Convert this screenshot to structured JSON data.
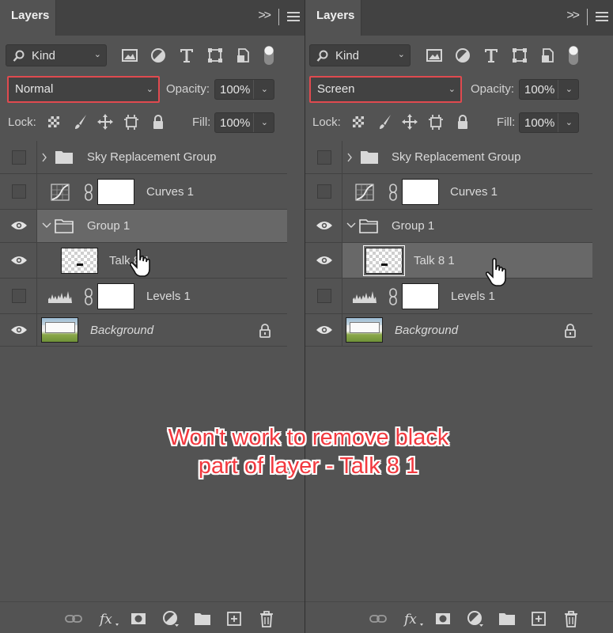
{
  "panels": [
    {
      "tab": "Layers",
      "kind_filter": "Kind",
      "blend_mode": "Normal",
      "opacity_label": "Opacity:",
      "opacity_value": "100%",
      "lock_label": "Lock:",
      "fill_label": "Fill:",
      "fill_value": "100%",
      "layers": [
        {
          "name": "Sky Replacement Group",
          "visible": false
        },
        {
          "name": "Curves 1",
          "visible": false
        },
        {
          "name": "Group 1",
          "visible": true
        },
        {
          "name": "Talk 8 1",
          "visible": true
        },
        {
          "name": "Levels 1",
          "visible": false
        },
        {
          "name": "Background",
          "visible": true
        }
      ]
    },
    {
      "tab": "Layers",
      "kind_filter": "Kind",
      "blend_mode": "Screen",
      "opacity_label": "Opacity:",
      "opacity_value": "100%",
      "lock_label": "Lock:",
      "fill_label": "Fill:",
      "fill_value": "100%",
      "layers": [
        {
          "name": "Sky Replacement Group",
          "visible": false
        },
        {
          "name": "Curves 1",
          "visible": false
        },
        {
          "name": "Group 1",
          "visible": true
        },
        {
          "name": "Talk 8 1",
          "visible": true
        },
        {
          "name": "Levels 1",
          "visible": false
        },
        {
          "name": "Background",
          "visible": true
        }
      ]
    }
  ],
  "caption": {
    "line1": "Won't work to remove black",
    "line2": "part of layer - Talk 8 1"
  },
  "colors": {
    "highlight_border": "#e04a4f",
    "caption_text": "#f2393f"
  },
  "icons": {
    "collapse": "double-chevron-right-icon",
    "panel_menu": "hamburger-menu-icon",
    "filters": [
      "pixel-filter-icon",
      "adjustment-filter-icon",
      "type-filter-icon",
      "shape-filter-icon",
      "smart-object-filter-icon",
      "filter-toggle-icon"
    ],
    "footer": [
      "link-layers-icon",
      "fx-icon",
      "add-mask-icon",
      "new-adjustment-icon",
      "new-group-icon",
      "new-layer-icon",
      "delete-icon"
    ]
  }
}
